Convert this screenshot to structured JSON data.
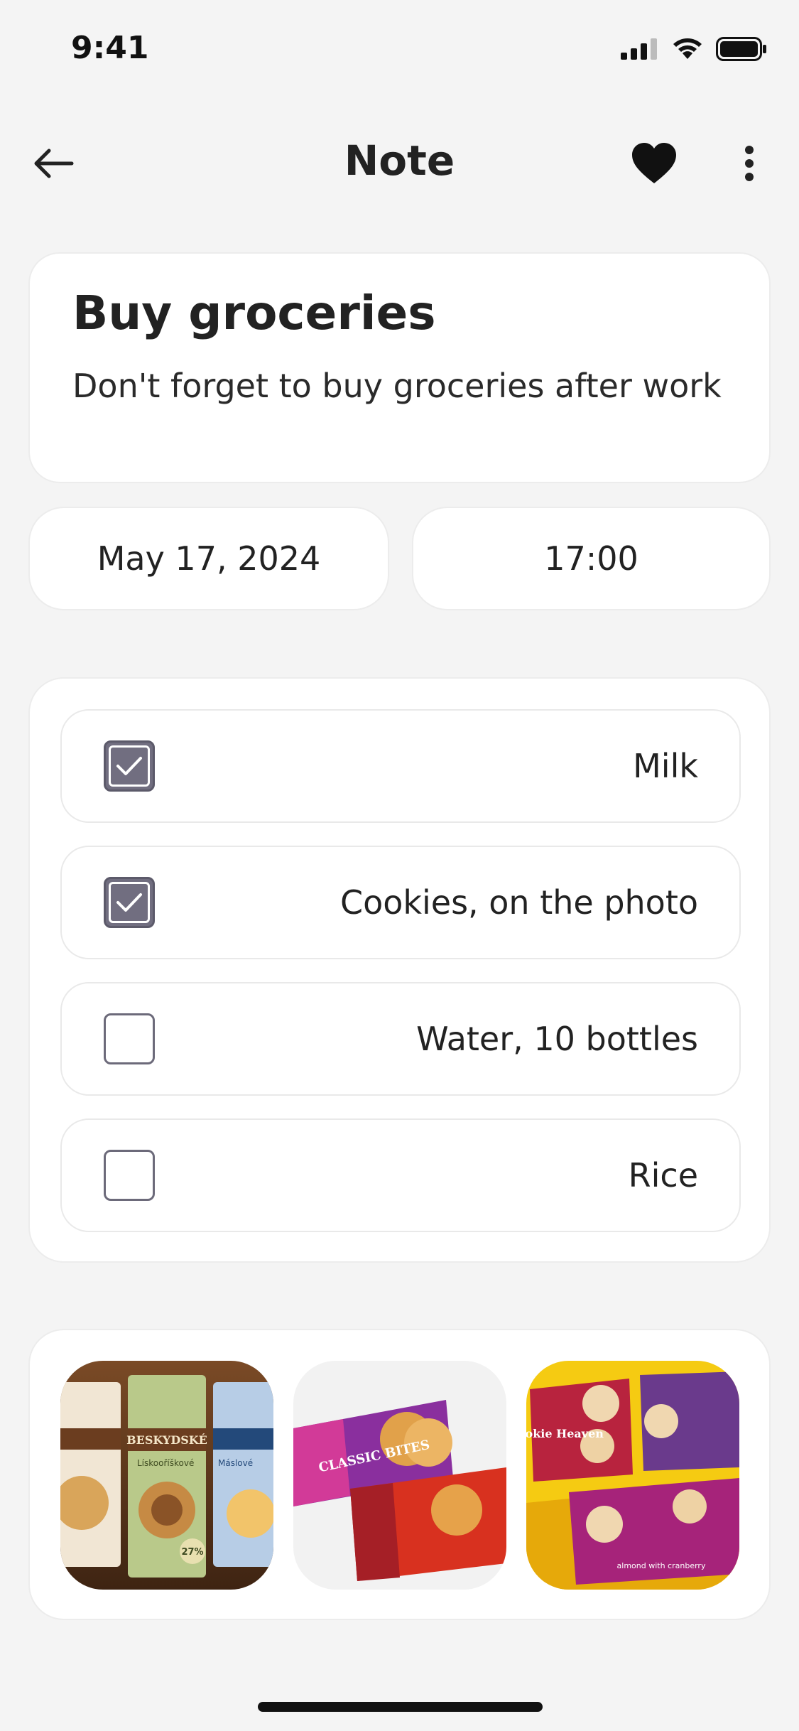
{
  "status_bar": {
    "time": "9:41"
  },
  "nav": {
    "title": "Note"
  },
  "note": {
    "title": "Buy groceries",
    "description": "Don't forget to buy groceries after work"
  },
  "date": "May 17, 2024",
  "time": "17:00",
  "checklist": [
    {
      "label": "Milk",
      "checked": true
    },
    {
      "label": "Cookies, on the photo",
      "checked": true
    },
    {
      "label": "Water, 10 bottles",
      "checked": false
    },
    {
      "label": "Rice",
      "checked": false
    }
  ],
  "photos": {
    "photo1": {
      "brand": "BESKYDSKÉ",
      "text_a": "Lískooříškové",
      "text_b": "Máslové",
      "badge": "27%"
    },
    "photo2": {
      "brand": "CLASSIC BITES"
    },
    "photo3": {
      "brand": "Cookie Heaven",
      "sub": "almond with cranberry"
    }
  },
  "colors": {
    "background": "#f4f4f4",
    "card": "#ffffff",
    "checkbox_checked": "#716e80",
    "text": "#222222"
  }
}
